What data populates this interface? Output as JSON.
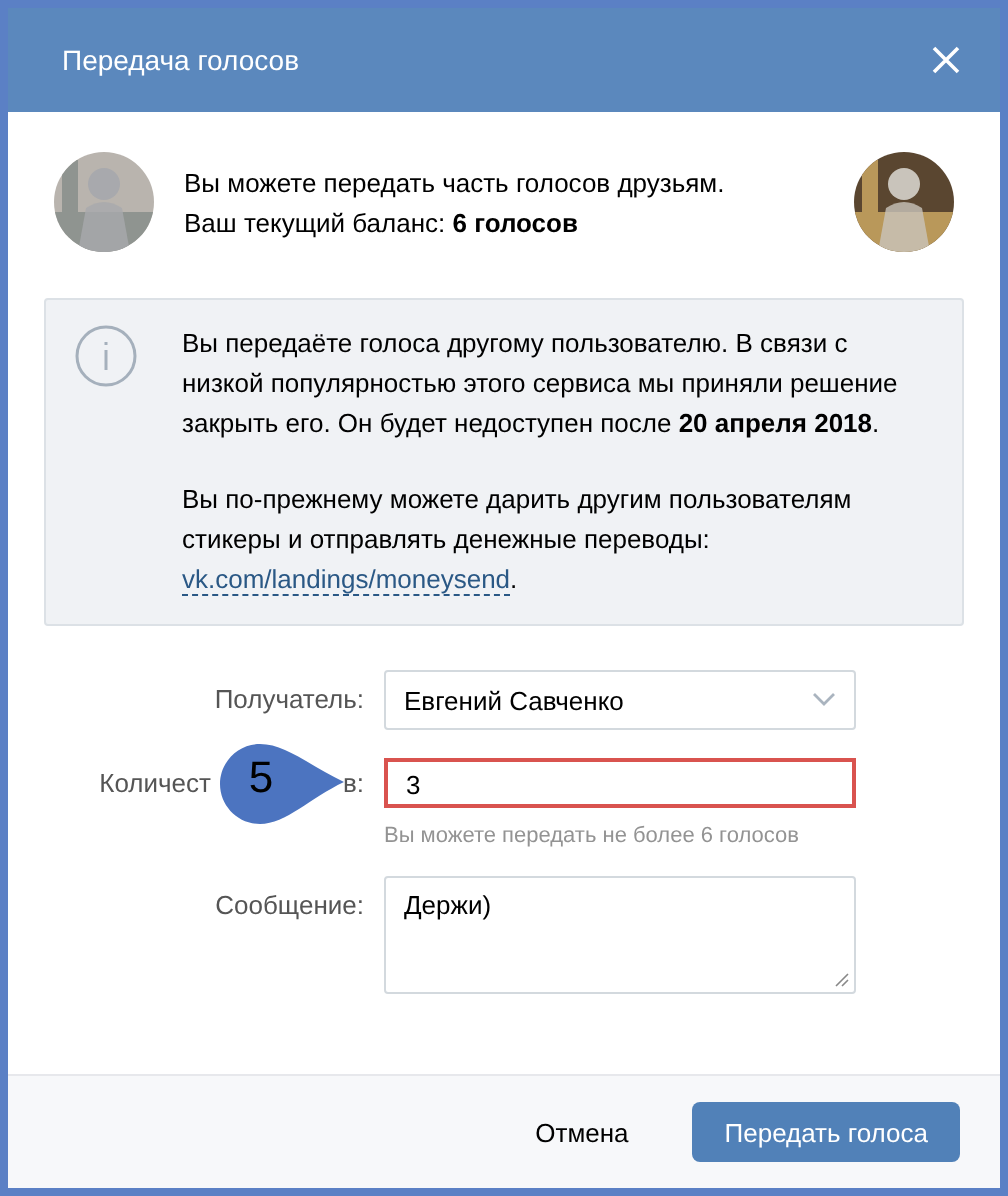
{
  "window": {
    "title": "Передача голосов"
  },
  "intro": {
    "lines": [
      "Вы можете передать часть голосов друзьям.",
      "Ваш текущий баланс: **6 голосов**"
    ]
  },
  "notice": {
    "paragraph": "Вы передаёте голоса другому пользователю. В связи с низкой популярностью этого сервиса мы приняли решение закрыть его. Он будет недоступен после **20 апреля 2018**.",
    "text": "Вы по-прежнему можете дарить другим пользователям стикеры и отправлять денежные переводы:",
    "link": "vk.com/landings/moneysend",
    "text_end": "."
  },
  "form": {
    "recipient": {
      "label": "Получатель:",
      "value": "Евгений Савченко"
    },
    "count": {
      "label_parts": [
        "Количест",
        "в:"
      ],
      "value": "3",
      "invalid": true,
      "hint": "Вы можете передать не более 6 голосов"
    },
    "message": {
      "label": "Сообщение:",
      "value": "Держи)"
    }
  },
  "callout": {
    "number": "5"
  },
  "buttons": {
    "cancel": "Отмена",
    "submit": "Передать голоса"
  }
}
